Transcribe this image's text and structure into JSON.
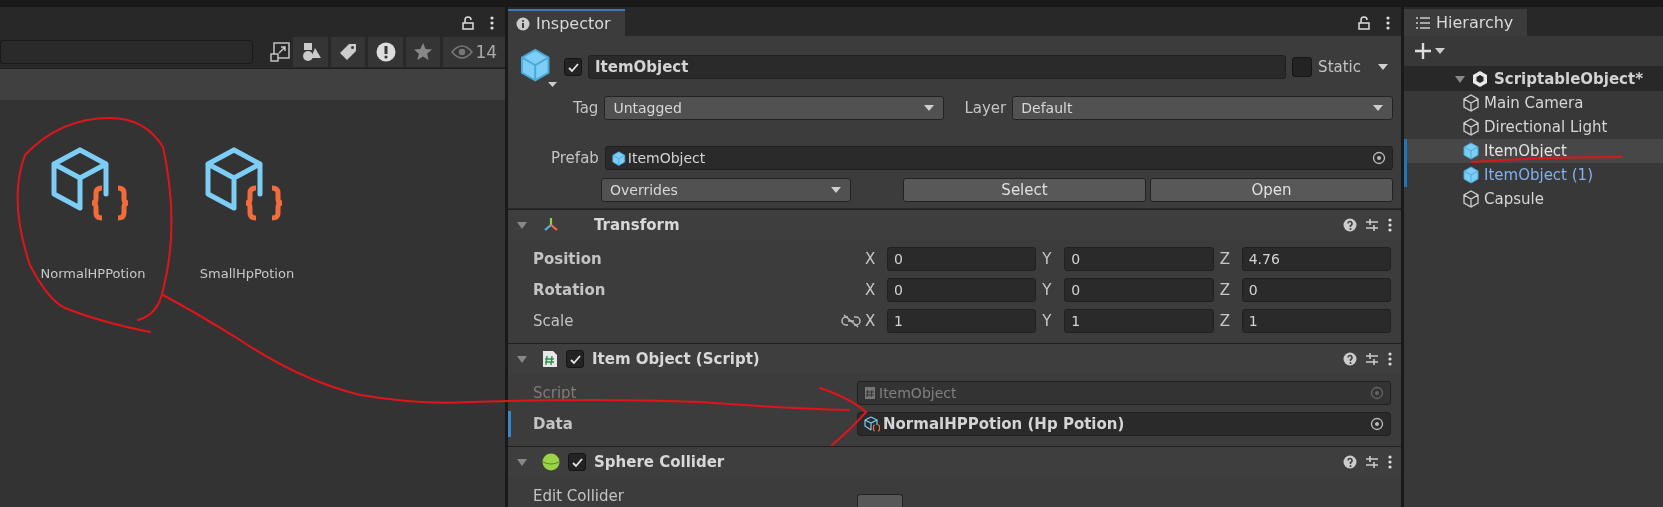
{
  "project_panel": {
    "filter_count": "14",
    "assets": [
      {
        "name": "NormalHPPotion"
      },
      {
        "name": "SmallHpPotion"
      }
    ]
  },
  "inspector": {
    "tab": "Inspector",
    "object": {
      "active": true,
      "name": "ItemObject",
      "static": false,
      "static_label": "Static",
      "tag_label": "Tag",
      "tag": "Untagged",
      "layer_label": "Layer",
      "layer": "Default",
      "prefab_label": "Prefab",
      "prefab": "ItemObject",
      "overrides": "Overrides",
      "buttons": [
        "Select",
        "Open"
      ]
    },
    "components": [
      {
        "kind": "transform",
        "title": "Transform",
        "rows": [
          {
            "label": "Position",
            "overridden": true,
            "linked": false,
            "axes": [
              {
                "label": "X",
                "value": "0"
              },
              {
                "label": "Y",
                "value": "0"
              },
              {
                "label": "Z",
                "value": "4.76"
              }
            ]
          },
          {
            "label": "Rotation",
            "overridden": true,
            "linked": false,
            "axes": [
              {
                "label": "X",
                "value": "0"
              },
              {
                "label": "Y",
                "value": "0"
              },
              {
                "label": "Z",
                "value": "0"
              }
            ]
          },
          {
            "label": "Scale",
            "overridden": false,
            "linked": true,
            "axes": [
              {
                "label": "X",
                "value": "1"
              },
              {
                "label": "Y",
                "value": "1"
              },
              {
                "label": "Z",
                "value": "1"
              }
            ]
          }
        ]
      },
      {
        "kind": "script",
        "title": "Item Object (Script)",
        "enabled": true,
        "fields": [
          {
            "label": "Script",
            "value": "ItemObject",
            "disabled": true,
            "overridden": false
          },
          {
            "label": "Data",
            "value": "NormalHPPotion (Hp Potion)",
            "disabled": false,
            "overridden": true
          }
        ]
      },
      {
        "kind": "collider",
        "title": "Sphere Collider",
        "enabled": true,
        "fields": [
          {
            "label": "Edit Collider"
          }
        ]
      }
    ]
  },
  "hierarchy": {
    "tab": "Hierarchy",
    "scene": {
      "name": "ScriptableObject*",
      "expanded": true,
      "children": [
        {
          "name": "Main Camera",
          "prefab": false,
          "selected": false,
          "overridden": false
        },
        {
          "name": "Directional Light",
          "prefab": false,
          "selected": false,
          "overridden": false
        },
        {
          "name": "ItemObject",
          "prefab": true,
          "selected": true,
          "overridden": true
        },
        {
          "name": "ItemObject (1)",
          "prefab": true,
          "selected": false,
          "overridden": true
        },
        {
          "name": "Capsule",
          "prefab": false,
          "selected": false,
          "overridden": false
        }
      ]
    }
  },
  "annotations": [
    {
      "kind": "circle"
    },
    {
      "kind": "arrow"
    },
    {
      "kind": "underline"
    }
  ]
}
